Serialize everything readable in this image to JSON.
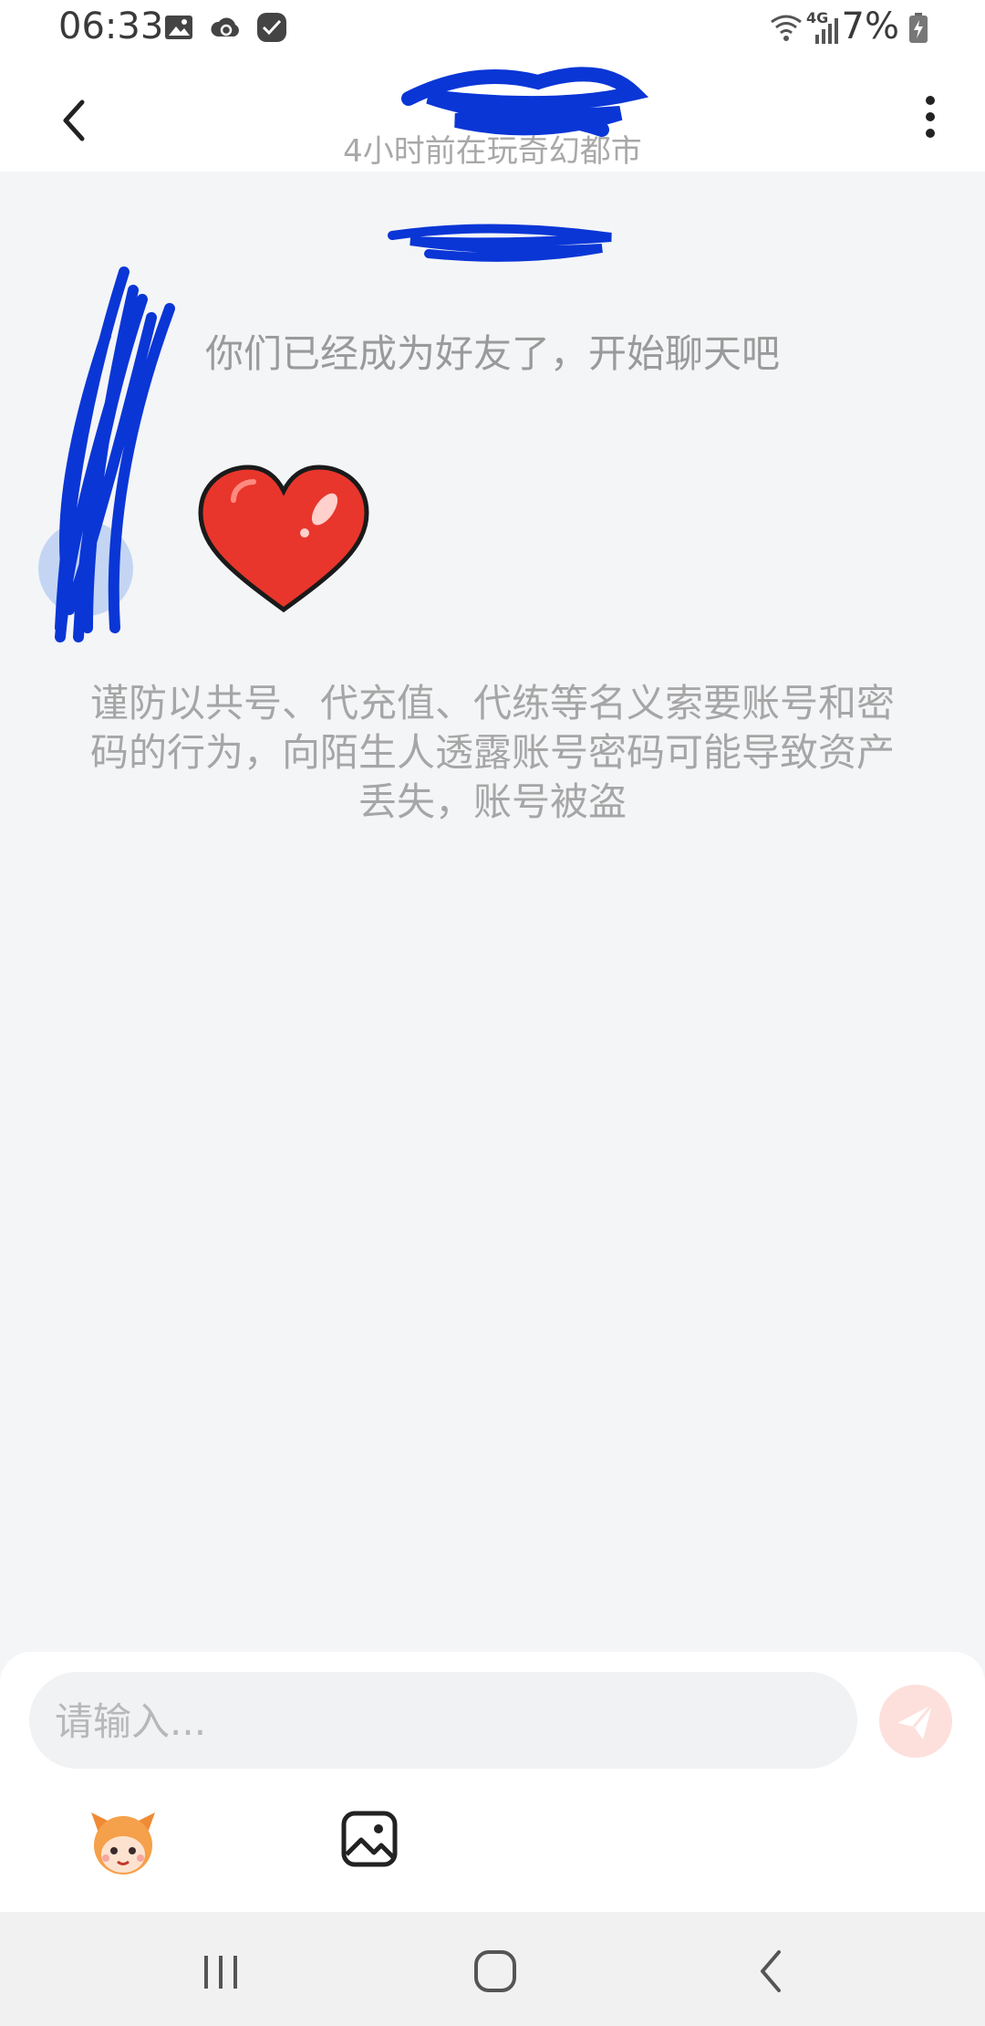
{
  "status_bar": {
    "time": "06:33",
    "network": "4G",
    "battery": "7%",
    "icons": [
      "image-icon",
      "cloud-sync-icon",
      "app-check-icon",
      "wifi-icon",
      "signal-icon",
      "battery-charging-icon"
    ]
  },
  "header": {
    "contact_status": "4小时前在玩奇幻都市",
    "back_icon": "chevron-left-icon",
    "menu_icon": "more-vertical-icon"
  },
  "chat": {
    "system_message": "你们已经成为好友了，开始聊天吧",
    "sticker_icon": "heart-icon",
    "warning_text": "谨防以共号、代充值、代练等名义索要账号和密码的行为，向陌生人透露账号密码可能导致资产丢失，账号被盗"
  },
  "input": {
    "placeholder": "请输入...",
    "send_icon": "paper-plane-icon",
    "emoji_icon": "mascot-emoji-icon",
    "image_icon": "image-icon"
  },
  "colors": {
    "background": "#f4f5f7",
    "redaction": "#0a36d6",
    "heart": "#e8362c",
    "send_button": "#fde0dc"
  }
}
